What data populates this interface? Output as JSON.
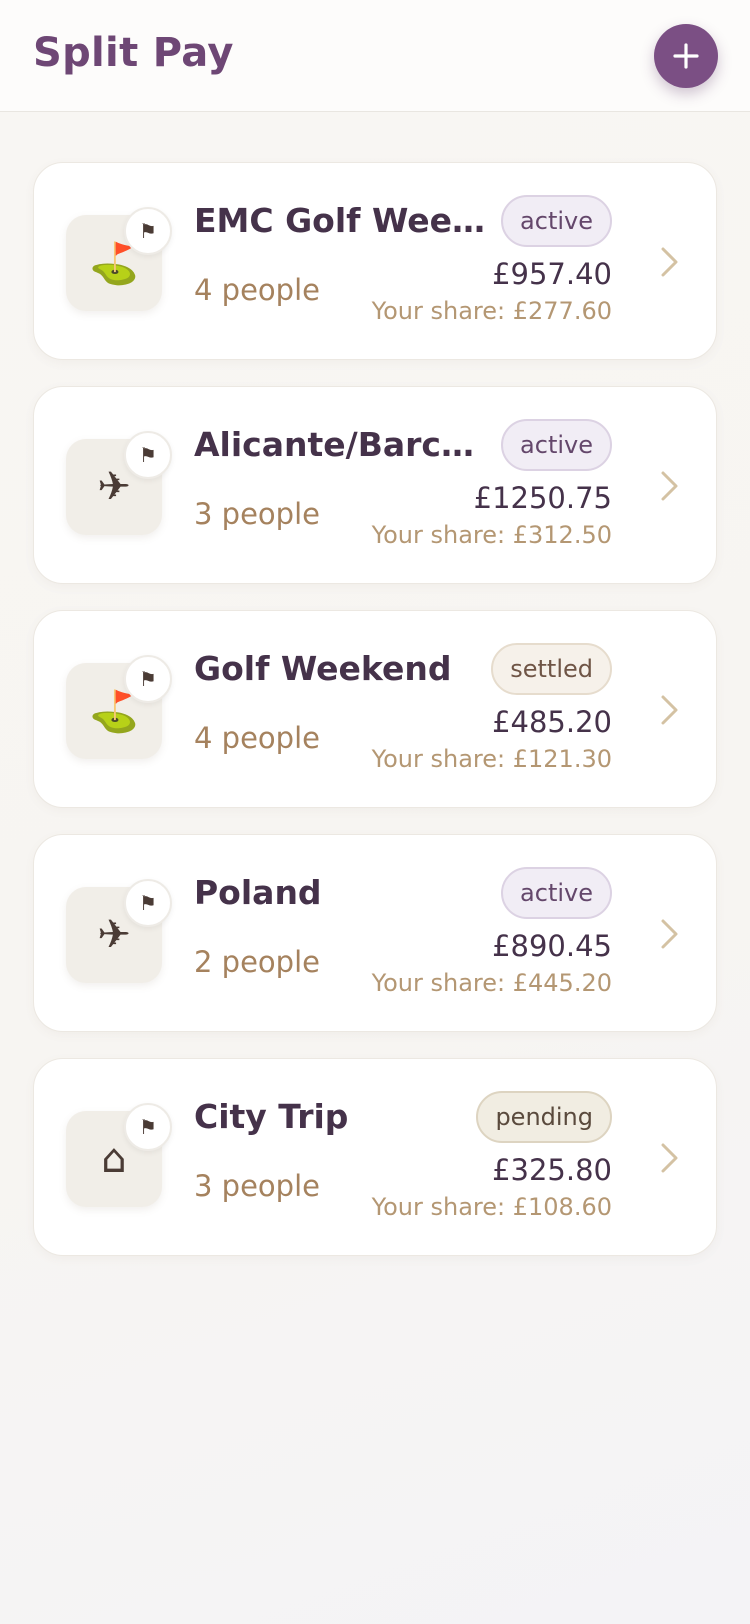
{
  "header": {
    "title": "Split Pay",
    "add_icon": "plus-icon"
  },
  "trips": [
    {
      "name": "EMC Golf Weekend",
      "people": "4 people",
      "status": "active",
      "total": "£957.40",
      "share": "Your share: £277.60",
      "icon": "golf-icon",
      "flag_icon": "flag-icon"
    },
    {
      "name": "Alicante/Barcelona",
      "people": "3 people",
      "status": "active",
      "total": "£1250.75",
      "share": "Your share: £312.50",
      "icon": "airplane-icon",
      "flag_icon": "flag-icon"
    },
    {
      "name": "Golf Weekend",
      "people": "4 people",
      "status": "settled",
      "total": "£485.20",
      "share": "Your share: £121.30",
      "icon": "golf-icon",
      "flag_icon": "flag-icon"
    },
    {
      "name": "Poland",
      "people": "2 people",
      "status": "active",
      "total": "£890.45",
      "share": "Your share: £445.20",
      "icon": "airplane-icon",
      "flag_icon": "flag-icon"
    },
    {
      "name": "City Trip",
      "people": "3 people",
      "status": "pending",
      "total": "£325.80",
      "share": "Your share: £108.60",
      "icon": "city-icon",
      "flag_icon": "flag-icon"
    }
  ],
  "colors": {
    "brand": "#7b4f84",
    "title": "#6e4775",
    "muted": "#a5825e",
    "chevron": "#d4c2a3"
  }
}
